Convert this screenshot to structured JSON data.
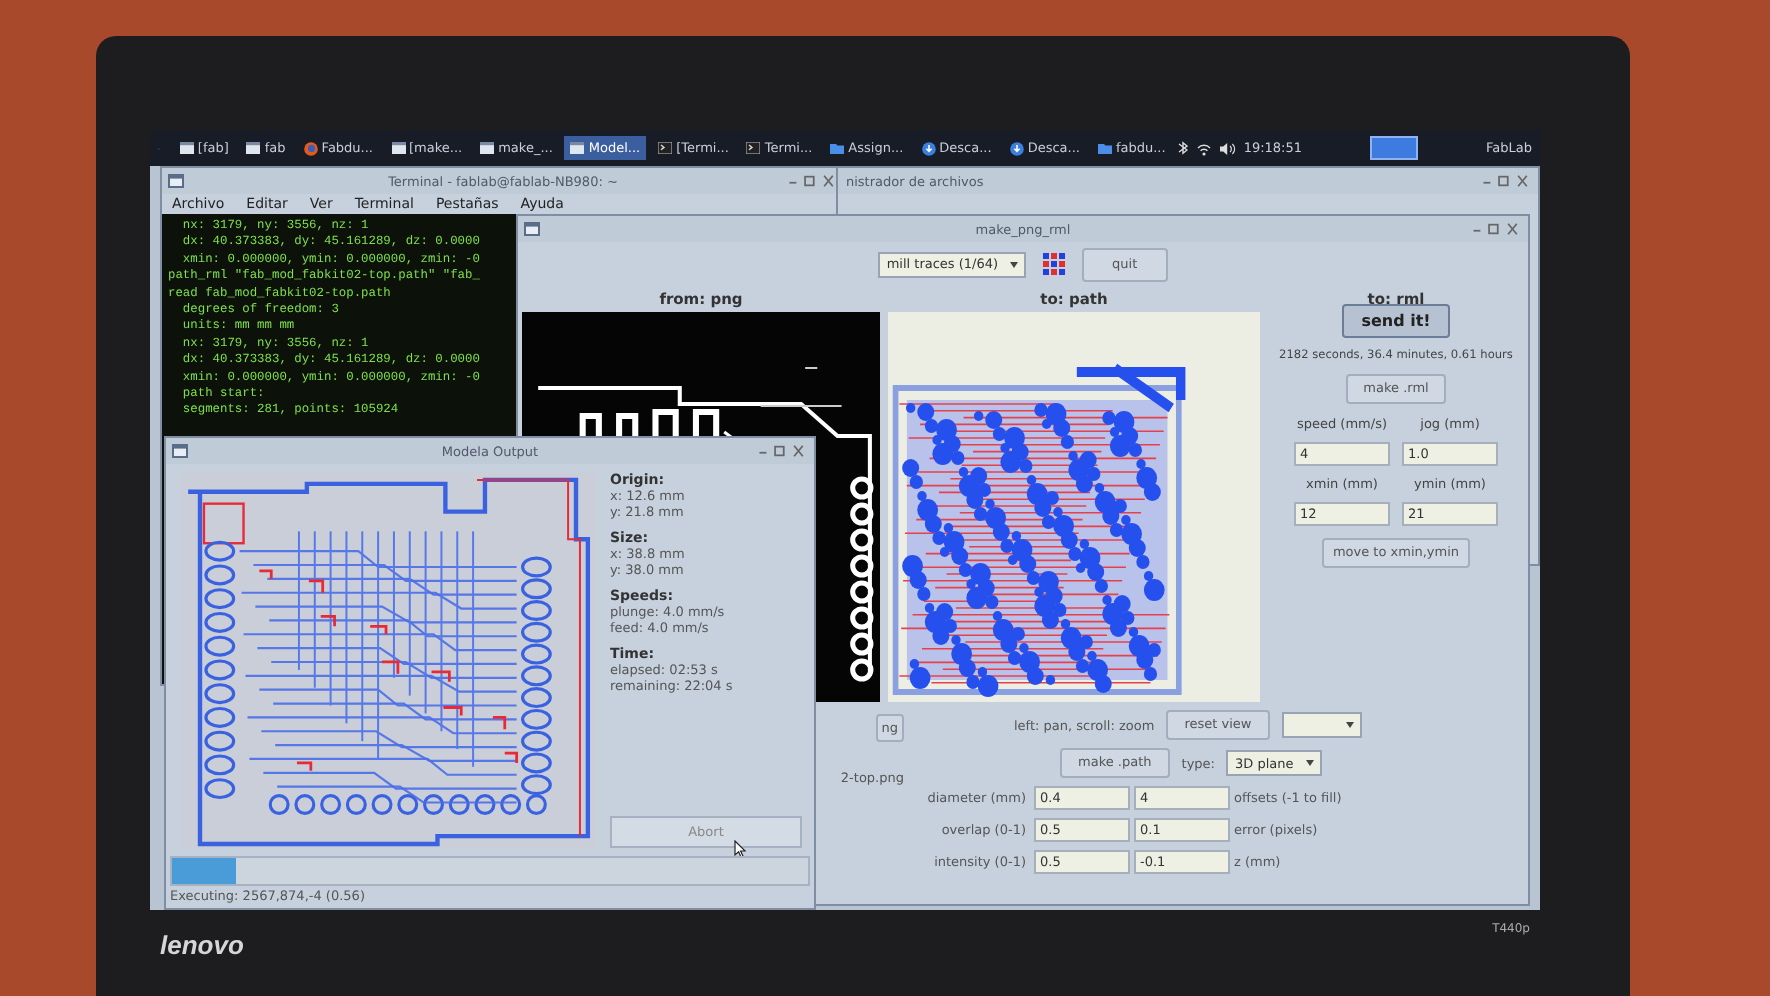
{
  "taskbar": {
    "items": [
      {
        "label": "[fab]",
        "kind": "window",
        "selected": false
      },
      {
        "label": "fab",
        "kind": "window",
        "selected": false
      },
      {
        "label": "Fabdu...",
        "kind": "browser",
        "selected": false
      },
      {
        "label": "[make...",
        "kind": "window",
        "selected": false
      },
      {
        "label": "make_...",
        "kind": "window",
        "selected": false
      },
      {
        "label": "Model...",
        "kind": "window",
        "selected": true
      },
      {
        "label": "[Termi...",
        "kind": "terminal",
        "selected": false
      },
      {
        "label": "Termi...",
        "kind": "terminal",
        "selected": false
      },
      {
        "label": "Assign...",
        "kind": "folder",
        "selected": false
      },
      {
        "label": "Desca...",
        "kind": "download",
        "selected": false
      },
      {
        "label": "Desca...",
        "kind": "download",
        "selected": false
      },
      {
        "label": "fabdu...",
        "kind": "folder",
        "selected": false
      }
    ],
    "clock": "19:18:51",
    "user": "FabLab"
  },
  "terminal": {
    "title": "Terminal - fablab@fablab-NB980: ~",
    "menu": [
      "Archivo",
      "Editar",
      "Ver",
      "Terminal",
      "Pestañas",
      "Ayuda"
    ],
    "lines": [
      "  nx: 3179, ny: 3556, nz: 1",
      "  dx: 40.373383, dy: 45.161289, dz: 0.0000",
      "  xmin: 0.000000, ymin: 0.000000, zmin: -0",
      "path_rml \"fab_mod_fabkit02-top.path\" \"fab_",
      "read fab_mod_fabkit02-top.path",
      "  degrees of freedom: 3",
      "  units: mm mm mm",
      "  nx: 3179, ny: 3556, nz: 1",
      "  dx: 40.373383, dy: 45.161289, dz: 0.0000",
      "  xmin: 0.000000, ymin: 0.000000, zmin: -0",
      "  path start:",
      "  segments: 281, points: 105924"
    ]
  },
  "file_manager": {
    "title": "nistrador de archivos"
  },
  "make_png": {
    "title": "make_png_rml",
    "mode": "mill traces (1/64)",
    "quit": "quit",
    "columns": [
      "from: png",
      "to: path",
      "to: rml"
    ],
    "send": "send it!",
    "estimate": "2182 seconds, 36.4 minutes, 0.61 hours",
    "make_rml": "make .rml",
    "fields": [
      {
        "label": "speed (mm/s)",
        "value": "4"
      },
      {
        "label": "jog (mm)",
        "value": "1.0"
      },
      {
        "label": "xmin (mm)",
        "value": "12"
      },
      {
        "label": "ymin (mm)",
        "value": "21"
      }
    ],
    "move": "move to xmin,ymin",
    "load": "ng",
    "file_name": "2-top.png",
    "view_hint": "left: pan, scroll: zoom",
    "reset_view": "reset view",
    "make_path": "make .path",
    "type_label": "type:",
    "type": "3D plane",
    "params": [
      {
        "label": "diameter (mm)",
        "value_1": "0.4",
        "value_2": "4",
        "label_2": "offsets (-1 to fill)"
      },
      {
        "label": "overlap (0-1)",
        "value_1": "0.5",
        "value_2": "0.1",
        "label_2": "error (pixels)"
      },
      {
        "label": "intensity (0-1)",
        "value_1": "0.5",
        "value_2": "-0.1",
        "label_2": "z (mm)"
      }
    ]
  },
  "modela": {
    "title": "Modela Output",
    "info": [
      {
        "heading": "Origin:",
        "lines": [
          "x: 12.6 mm",
          "y: 21.8 mm"
        ]
      },
      {
        "heading": "Size:",
        "lines": [
          "x: 38.8 mm",
          "y: 38.0 mm"
        ]
      },
      {
        "heading": "Speeds:",
        "lines": [
          "plunge: 4.0 mm/s",
          "feed: 4.0 mm/s"
        ]
      },
      {
        "heading": "Time:",
        "lines": [
          "elapsed: 02:53 s",
          "remaining: 22:04 s"
        ]
      }
    ],
    "abort": "Abort",
    "progress": {
      "level": 0.1
    },
    "status": "Executing: 2567,874,-4 (0.56)"
  },
  "bezel": {
    "brand": "lenovo",
    "model": "T440p"
  }
}
